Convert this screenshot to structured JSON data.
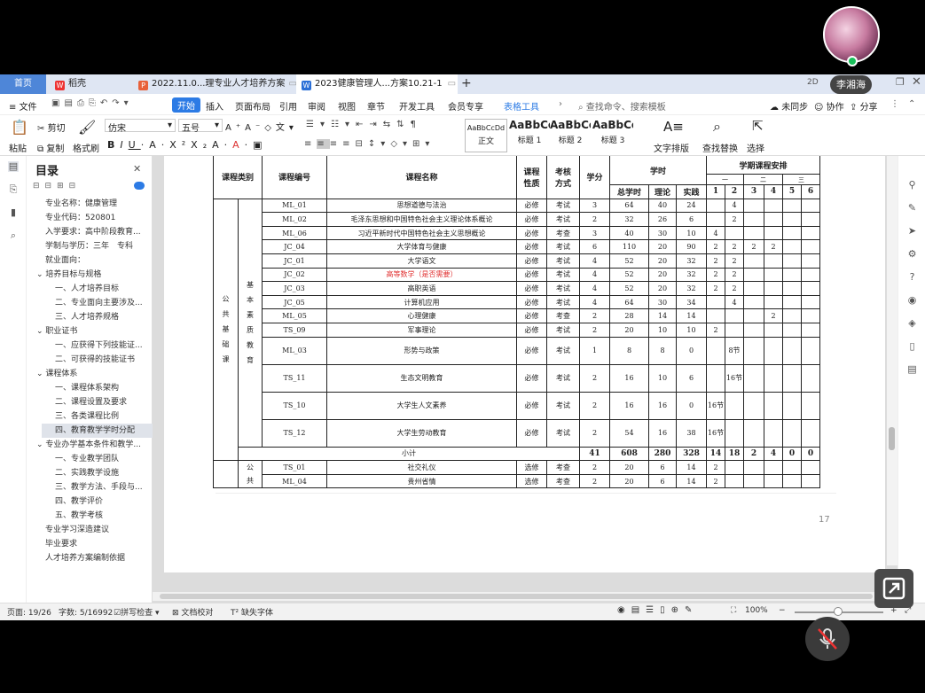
{
  "overlay": {
    "user_name": "李湘海"
  },
  "tabs": [
    {
      "label": "首页"
    },
    {
      "label": "稻壳",
      "icon": "wps-logo-icon"
    },
    {
      "label": "2022.11.0...理专业人才培养方案",
      "icon": "pdf-icon"
    },
    {
      "label": "2023健康管理人...方案10.21-1",
      "icon": "word-icon"
    }
  ],
  "ribbon_tabs": [
    "文件",
    "开始",
    "插入",
    "页面布局",
    "引用",
    "审阅",
    "视图",
    "章节",
    "开发工具",
    "会员专享",
    "表格工具"
  ],
  "search": {
    "placeholder": "查找命令、搜索模板"
  },
  "top_right": {
    "sync": "未同步",
    "collab": "协作",
    "share": "分享"
  },
  "ribbon": {
    "paste": "粘贴",
    "cut": "剪切",
    "copy": "复制",
    "format_painter": "格式刷",
    "font_name": "仿宋",
    "font_size": "五号",
    "styles": [
      {
        "sample": "AaBbCcDd",
        "name": "正文"
      },
      {
        "sample": "AaBbCcI",
        "name": "标题 1"
      },
      {
        "sample": "AaBbCcI",
        "name": "标题 2"
      },
      {
        "sample": "AaBbCc",
        "name": "标题 3"
      }
    ],
    "text_layout": "文字排版",
    "find_replace": "查找替换",
    "select": "选择"
  },
  "toc": {
    "title": "目录",
    "items": [
      {
        "label": "专业名称：健康管理",
        "level": 0
      },
      {
        "label": "专业代码：520801",
        "level": 0
      },
      {
        "label": "入学要求：高中阶段教育...",
        "level": 0
      },
      {
        "label": "学制与学历：三年　专科",
        "level": 0
      },
      {
        "label": "就业面向：",
        "level": 0
      },
      {
        "label": "培养目标与规格",
        "level": 1
      },
      {
        "label": "一、人才培养目标",
        "level": 2
      },
      {
        "label": "二、专业面向主要涉及...",
        "level": 2
      },
      {
        "label": "三、人才培养规格",
        "level": 2
      },
      {
        "label": "职业证书",
        "level": 1
      },
      {
        "label": "一、应获得下列技能证...",
        "level": 2
      },
      {
        "label": "二、可获得的技能证书",
        "level": 2
      },
      {
        "label": "课程体系",
        "level": 1
      },
      {
        "label": "一、课程体系架构",
        "level": 2
      },
      {
        "label": "二、课程设置及要求",
        "level": 2
      },
      {
        "label": "三、各类课程比例",
        "level": 2
      },
      {
        "label": "四、教育教学学时分配",
        "level": 2,
        "selected": true
      },
      {
        "label": "专业办学基本条件和教学...",
        "level": 1
      },
      {
        "label": "一、专业教学团队",
        "level": 2
      },
      {
        "label": "二、实践教学设施",
        "level": 2
      },
      {
        "label": "三、教学方法、手段与...",
        "level": 2
      },
      {
        "label": "四、教学评价",
        "level": 2
      },
      {
        "label": "五、教学考核",
        "level": 2
      },
      {
        "label": "专业学习深造建议",
        "level": 0
      },
      {
        "label": "毕业要求",
        "level": 0
      },
      {
        "label": "人才培养方案编制依据",
        "level": 0
      }
    ]
  },
  "table": {
    "headers": {
      "category": "课程类别",
      "code": "课程编号",
      "name": "课程名称",
      "nature": "课程性质",
      "exam": "考核方式",
      "credit": "学分",
      "hours": "学时",
      "total": "总学时",
      "theory": "理论",
      "practice": "实践",
      "schedule": "学期课程安排",
      "years": [
        "一",
        "二",
        "三"
      ],
      "terms": [
        "1",
        "2",
        "3",
        "4",
        "5",
        "6"
      ]
    },
    "group1": "公共基础课",
    "group2": "基本素质教育",
    "group3": "公共",
    "rows": [
      {
        "code": "ML_01",
        "name": "思想道德与法治",
        "nat": "必修",
        "exam": "考试",
        "cr": "3",
        "tot": "64",
        "th": "40",
        "pr": "24",
        "t": [
          "",
          "4",
          "",
          "",
          "",
          ""
        ]
      },
      {
        "code": "ML_02",
        "name": "毛泽东思想和中国特色社会主义理论体系概论",
        "nat": "必修",
        "exam": "考试",
        "cr": "2",
        "tot": "32",
        "th": "26",
        "pr": "6",
        "t": [
          "",
          "2",
          "",
          "",
          "",
          ""
        ]
      },
      {
        "code": "ML_06",
        "name": "习近平新时代中国特色社会主义思想概论",
        "nat": "必修",
        "exam": "考查",
        "cr": "3",
        "tot": "40",
        "th": "30",
        "pr": "10",
        "t": [
          "4",
          "",
          "",
          "",
          "",
          ""
        ]
      },
      {
        "code": "JC_04",
        "name": "大学体育与健康",
        "nat": "必修",
        "exam": "考试",
        "cr": "6",
        "tot": "110",
        "th": "20",
        "pr": "90",
        "t": [
          "2",
          "2",
          "2",
          "2",
          "",
          ""
        ]
      },
      {
        "code": "JC_01",
        "name": "大学语文",
        "nat": "必修",
        "exam": "考试",
        "cr": "4",
        "tot": "52",
        "th": "20",
        "pr": "32",
        "t": [
          "2",
          "2",
          "",
          "",
          "",
          ""
        ]
      },
      {
        "code": "JC_02",
        "name": "高等数学（是否需要）",
        "nat": "必修",
        "exam": "考试",
        "cr": "4",
        "tot": "52",
        "th": "20",
        "pr": "32",
        "t": [
          "2",
          "2",
          "",
          "",
          "",
          ""
        ],
        "red": true
      },
      {
        "code": "JC_03",
        "name": "高职英语",
        "nat": "必修",
        "exam": "考试",
        "cr": "4",
        "tot": "52",
        "th": "20",
        "pr": "32",
        "t": [
          "2",
          "2",
          "",
          "",
          "",
          ""
        ]
      },
      {
        "code": "JC_05",
        "name": "计算机应用",
        "nat": "必修",
        "exam": "考试",
        "cr": "4",
        "tot": "64",
        "th": "30",
        "pr": "34",
        "t": [
          "",
          "4",
          "",
          "",
          "",
          ""
        ],
        "sel": true
      },
      {
        "code": "ML_05",
        "name": "心理健康",
        "nat": "必修",
        "exam": "考查",
        "cr": "2",
        "tot": "28",
        "th": "14",
        "pr": "14",
        "t": [
          "",
          "",
          "",
          "2",
          "",
          ""
        ]
      },
      {
        "code": "TS_09",
        "name": "军事理论",
        "nat": "必修",
        "exam": "考试",
        "cr": "2",
        "tot": "20",
        "th": "10",
        "pr": "10",
        "t": [
          "2",
          "",
          "",
          "",
          "",
          ""
        ]
      },
      {
        "code": "ML_03",
        "name": "形势与政策",
        "nat": "必修",
        "exam": "考试",
        "cr": "1",
        "tot": "8",
        "th": "8",
        "pr": "0",
        "t": [
          "",
          "8节",
          "",
          "",
          "",
          ""
        ],
        "tall": true
      },
      {
        "code": "TS_11",
        "name": "生态文明教育",
        "nat": "必修",
        "exam": "考试",
        "cr": "2",
        "tot": "16",
        "th": "10",
        "pr": "6",
        "t": [
          "",
          "16节",
          "",
          "",
          "",
          ""
        ],
        "tall": true
      },
      {
        "code": "TS_10",
        "name": "大学生人文素养",
        "nat": "必修",
        "exam": "考试",
        "cr": "2",
        "tot": "16",
        "th": "16",
        "pr": "0",
        "t": [
          "16节",
          "",
          "",
          "",
          "",
          ""
        ],
        "tall": true
      },
      {
        "code": "TS_12",
        "name": "大学生劳动教育",
        "nat": "必修",
        "exam": "考试",
        "cr": "2",
        "tot": "54",
        "th": "16",
        "pr": "38",
        "t": [
          "16节",
          "",
          "",
          "",
          "",
          ""
        ],
        "tall": true
      }
    ],
    "subtotal": {
      "label": "小计",
      "cr": "41",
      "tot": "608",
      "th": "280",
      "pr": "328",
      "t": [
        "14",
        "18",
        "2",
        "4",
        "0",
        "0"
      ]
    },
    "rows2": [
      {
        "code": "TS_01",
        "name": "社交礼仪",
        "nat": "选修",
        "exam": "考查",
        "cr": "2",
        "tot": "20",
        "th": "6",
        "pr": "14",
        "t": [
          "2",
          "",
          "",
          "",
          "",
          ""
        ]
      },
      {
        "code": "ML_04",
        "name": "贵州省情",
        "nat": "选修",
        "exam": "考查",
        "cr": "2",
        "tot": "20",
        "th": "6",
        "pr": "14",
        "t": [
          "2",
          "",
          "",
          "",
          "",
          ""
        ]
      }
    ]
  },
  "page_number": "17",
  "status": {
    "page": "页面: 19/26",
    "words": "字数: 5/16992",
    "spell": "拼写检查",
    "proof": "文档校对",
    "missing_font": "缺失字体",
    "zoom": "100%"
  }
}
